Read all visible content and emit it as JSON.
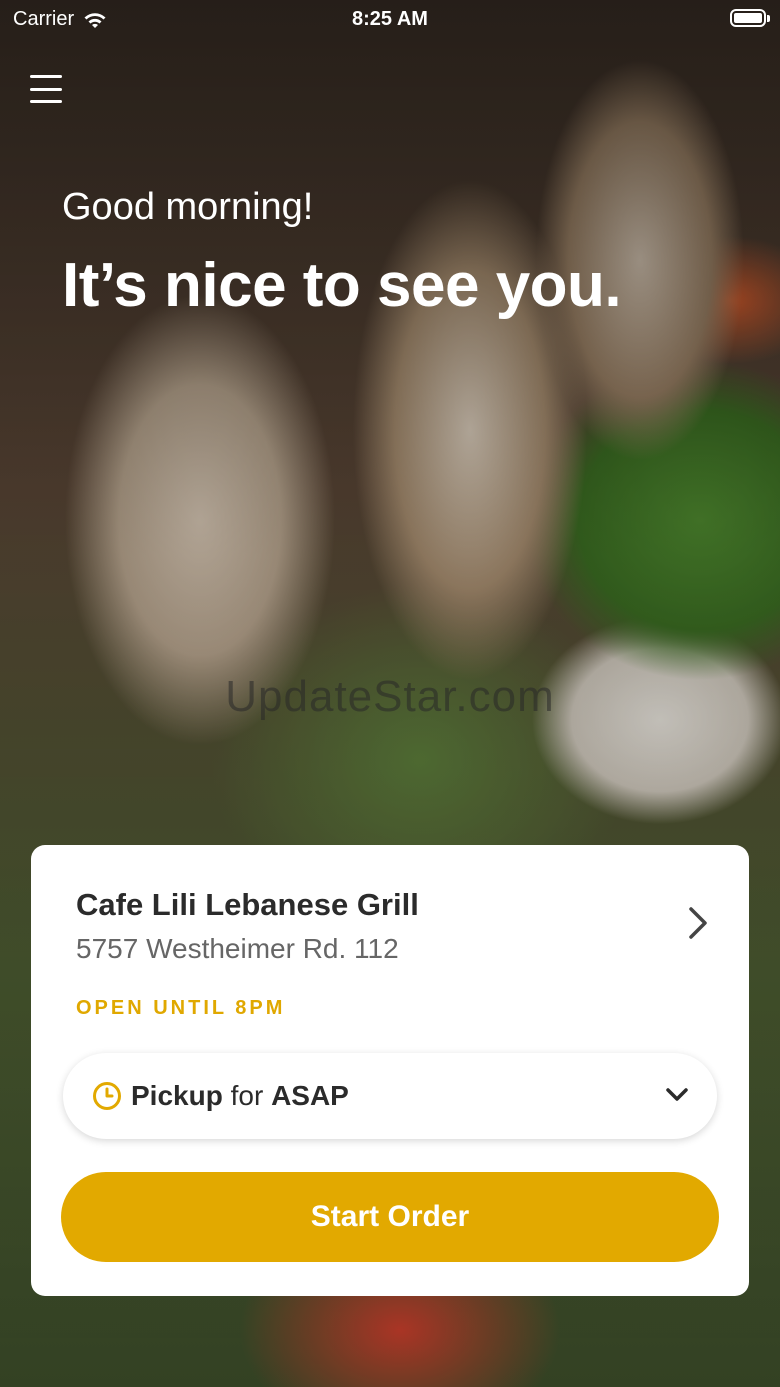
{
  "status_bar": {
    "carrier": "Carrier",
    "time": "8:25 AM"
  },
  "icons": {
    "menu": "menu-icon",
    "wifi": "wifi-icon",
    "battery": "battery-icon",
    "chevron_right": "chevron-right-icon",
    "clock": "clock-icon",
    "chevron_down": "chevron-down-icon"
  },
  "hero": {
    "greeting": "Good morning!",
    "headline": "It’s nice to see you."
  },
  "watermark": "UpdateStar.com",
  "store": {
    "name": "Cafe Lili Lebanese Grill",
    "address": "5757 Westheimer Rd. 112",
    "hours": "OPEN UNTIL 8PM"
  },
  "order": {
    "mode": "Pickup",
    "connector": "for",
    "time": "ASAP",
    "start_label": "Start Order"
  },
  "colors": {
    "accent": "#e2a900",
    "hours_text": "#e0a800",
    "card_bg": "#ffffff",
    "text_dark": "#2b2b2b"
  }
}
